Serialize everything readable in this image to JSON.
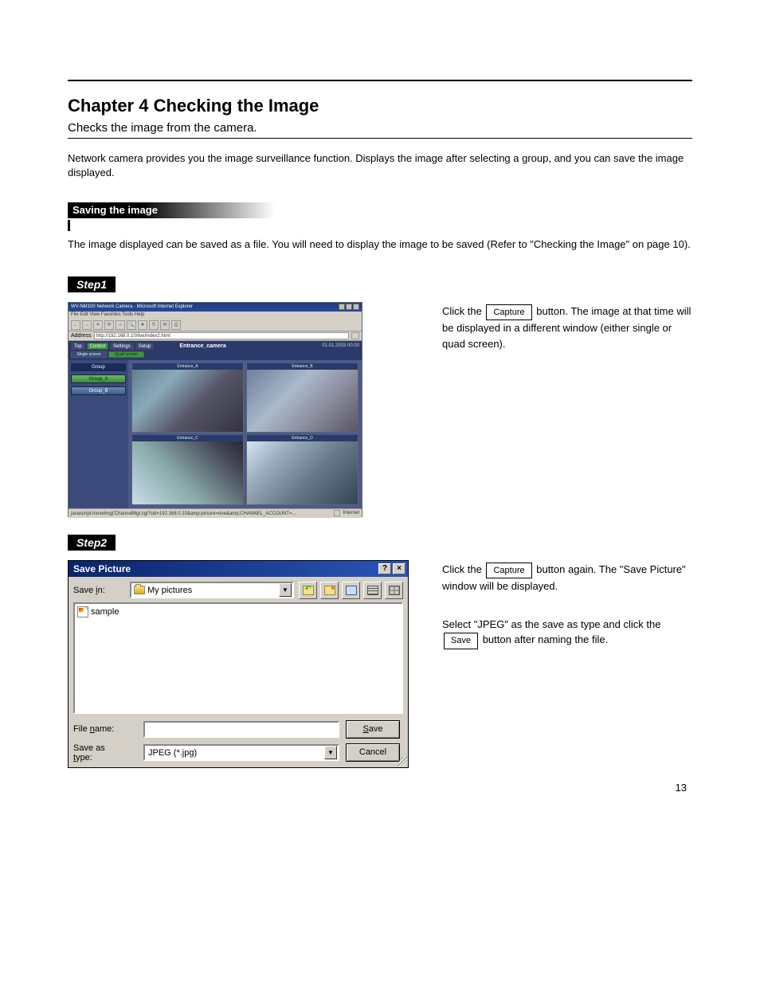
{
  "page_number": "13",
  "chapter": {
    "title": "Chapter 4 Checking the Image",
    "subtitle": "Checks the image from the camera.",
    "intro": "Network camera provides you the image surveillance function. Displays the image after selecting a group, and you can save the image displayed."
  },
  "section": {
    "title": "Saving the image",
    "intro": "The image displayed can be saved as a file. You will need to display the image to be saved (Refer to \"Checking the Image\" on page 10)."
  },
  "step1": {
    "label": "Step1",
    "text_before": "Click the ",
    "button": "Capture",
    "text_after": " button. The image at that time will be displayed in a different window (either single or quad screen)."
  },
  "cam_browser": {
    "window_title": "WV-NM100 Network Camera - Microsoft Internet Explorer",
    "menu": "File  Edit  View  Favorites  Tools  Help",
    "address_label": "Address",
    "address_value": "http://192.168.0.10/live/index2.html",
    "nav_tabs": [
      "Top",
      "Control",
      "Settings",
      "Setup"
    ],
    "content_title": "Entrance_camera",
    "timestamp": "01.01.2003  00:00",
    "subnav": [
      "Single screen",
      "Quad screen"
    ],
    "sidebar_header": "Group",
    "groups": [
      "Group_A",
      "Group_B"
    ],
    "cells": [
      "Entrance_A",
      "Entrance_B",
      "Entrance_C",
      "Entrance_D"
    ],
    "status_left": "javascript:moveImg('ChannelMgr.cgi?cid=192.168.0.10&amp;picture=one&amp;CHANNEL_ACCOUNT=…",
    "status_right": "Internet"
  },
  "step2": {
    "label": "Step2",
    "text1_a": "Click the ",
    "text1_button": "Capture",
    "text1_b": " button again. The \"Save Picture\" window will be displayed.",
    "text2_a": "Select \"JPEG\" as the save as type and click the ",
    "text2_button": "Save",
    "text2_b": " button after naming the file."
  },
  "save_dialog": {
    "title": "Save Picture",
    "help_btn": "?",
    "close_btn": "×",
    "save_in_label": "Save in:",
    "save_in_value": "My pictures",
    "file_sample": "sample",
    "file_name_label": "File name:",
    "file_name_value": "",
    "save_as_type_label": "Save as type:",
    "save_as_type_value": "JPEG (*.jpg)",
    "save_btn": "Save",
    "cancel_btn": "Cancel"
  }
}
